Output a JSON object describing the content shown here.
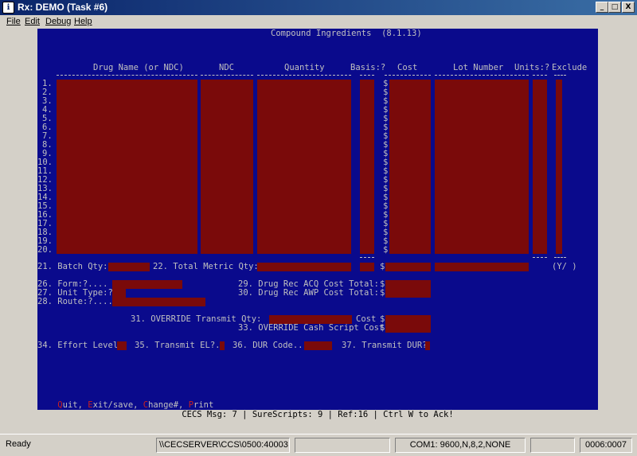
{
  "window": {
    "title": "Rx: DEMO  (Task #6)",
    "icon_glyph": "ℹ",
    "minimize": "_",
    "maximize": "□",
    "close": "X"
  },
  "menu": [
    "File",
    "Edit",
    "Debug",
    "Help"
  ],
  "screen": {
    "title": "Compound Ingredients  (8.1.13)",
    "headers": {
      "drug_name": "Drug Name (or NDC)",
      "ndc": "NDC",
      "quantity": "Quantity",
      "basis": "Basis:?",
      "cost": "Cost",
      "lot_number": "Lot Number",
      "units": "Units:?",
      "exclude": "Exclude"
    },
    "rows": [
      "1.",
      "2.",
      "3.",
      "4.",
      "5.",
      "6.",
      "7.",
      "8.",
      "9.",
      "10.",
      "11.",
      "12.",
      "13.",
      "14.",
      "15.",
      "16.",
      "17.",
      "18.",
      "19.",
      "20."
    ],
    "currency_symbol": "$",
    "batch_qty": "21. Batch Qty:",
    "total_metric_qty": "22. Total Metric Qty:",
    "exclude_hint": "(Y/ )",
    "form": "26. Form:?....",
    "unit_type": "27. Unit Type:?",
    "route": "28. Route:?....",
    "acq_cost_total": "29. Drug Rec ACQ Cost Total:",
    "awp_cost_total": "30. Drug Rec AWP Cost Total:",
    "override_transmit_qty": "31. OVERRIDE Transmit Qty:",
    "cost_label": "Cost",
    "override_cash_script": "33. OVERRIDE Cash Script Cost",
    "effort_level": "34. Effort Level",
    "transmit_el": "35. Transmit EL?.",
    "dur_code": "36. DUR Code..",
    "transmit_dur": "37. Transmit DUR?",
    "commands": [
      {
        "key": "Q",
        "rest": "uit, "
      },
      {
        "key": "E",
        "rest": "xit/save, "
      },
      {
        "key": "C",
        "rest": "hange#, "
      },
      {
        "key": "P",
        "rest": "rint"
      }
    ],
    "colors": {
      "background": "#0a0a8c",
      "field": "#7a0a0a",
      "text": "#c0c0c0"
    }
  },
  "message_line": "CECS Msg: 7 | SureScripts: 9 | Ref:16 | Ctrl W to Ack!",
  "statusbar": {
    "ready": "Ready",
    "server": "\\\\CECSERVER\\CCS\\0500:40003",
    "blank1": "",
    "com": "COM1: 9600,N,8,2,NONE",
    "blank2": "",
    "position": "0006:0007"
  }
}
